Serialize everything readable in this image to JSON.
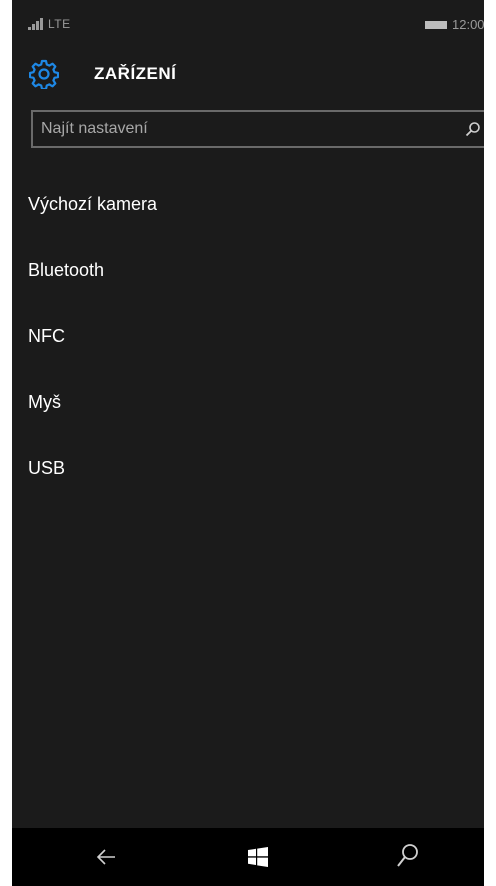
{
  "status_bar": {
    "network": "LTE",
    "time": "12:00",
    "signal_icon": "signal-bars-icon",
    "battery_icon": "battery-icon"
  },
  "header": {
    "icon": "gear-icon",
    "title": "ZAŘÍZENÍ"
  },
  "search": {
    "placeholder": "Najít nastavení",
    "icon": "search-icon"
  },
  "settings_list": {
    "items": [
      {
        "label": "Výchozí kamera"
      },
      {
        "label": "Bluetooth"
      },
      {
        "label": "NFC"
      },
      {
        "label": "Myš"
      },
      {
        "label": "USB"
      }
    ]
  },
  "nav_bar": {
    "back_icon": "back-arrow-icon",
    "start_icon": "windows-icon",
    "search_icon": "search-icon"
  },
  "colors": {
    "background": "#1b1b1b",
    "accent": "#1e88e5",
    "nav_background": "#000000",
    "text": "#ffffff"
  }
}
